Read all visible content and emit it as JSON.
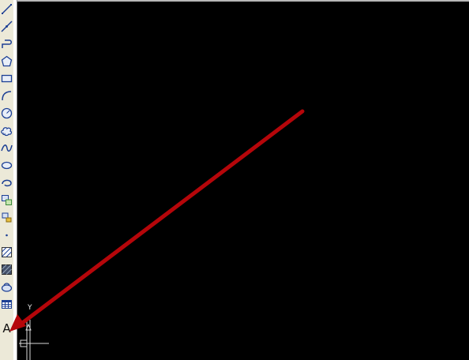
{
  "toolbar": {
    "tools": [
      {
        "name": "line-icon",
        "icon": "line"
      },
      {
        "name": "construction-line-icon",
        "icon": "xline"
      },
      {
        "name": "polyline-icon",
        "icon": "polyline"
      },
      {
        "name": "polygon-icon",
        "icon": "polygon"
      },
      {
        "name": "rectangle-icon",
        "icon": "rectangle"
      },
      {
        "name": "arc-icon",
        "icon": "arc"
      },
      {
        "name": "circle-icon",
        "icon": "circle"
      },
      {
        "name": "revision-cloud-icon",
        "icon": "cloud"
      },
      {
        "name": "spline-icon",
        "icon": "spline"
      },
      {
        "name": "ellipse-icon",
        "icon": "ellipse"
      },
      {
        "name": "ellipse-arc-icon",
        "icon": "ellipse-arc"
      },
      {
        "name": "insert-block-icon",
        "icon": "insert-block"
      },
      {
        "name": "make-block-icon",
        "icon": "make-block"
      },
      {
        "name": "point-icon",
        "icon": "point"
      },
      {
        "name": "hatch-icon",
        "icon": "hatch"
      },
      {
        "name": "gradient-icon",
        "icon": "gradient"
      },
      {
        "name": "region-icon",
        "icon": "region"
      },
      {
        "name": "table-icon",
        "icon": "table"
      }
    ],
    "text_tool_label": "A"
  },
  "canvas": {
    "background": "#000000",
    "ucs_y_label": "Y"
  },
  "annotation": {
    "arrow_color": "#b5060a"
  },
  "colors": {
    "toolbar_bg": "#ece9d8",
    "icon_blue": "#1c3f94",
    "icon_yellow": "#e8c040",
    "icon_green": "#3a8a3a"
  }
}
